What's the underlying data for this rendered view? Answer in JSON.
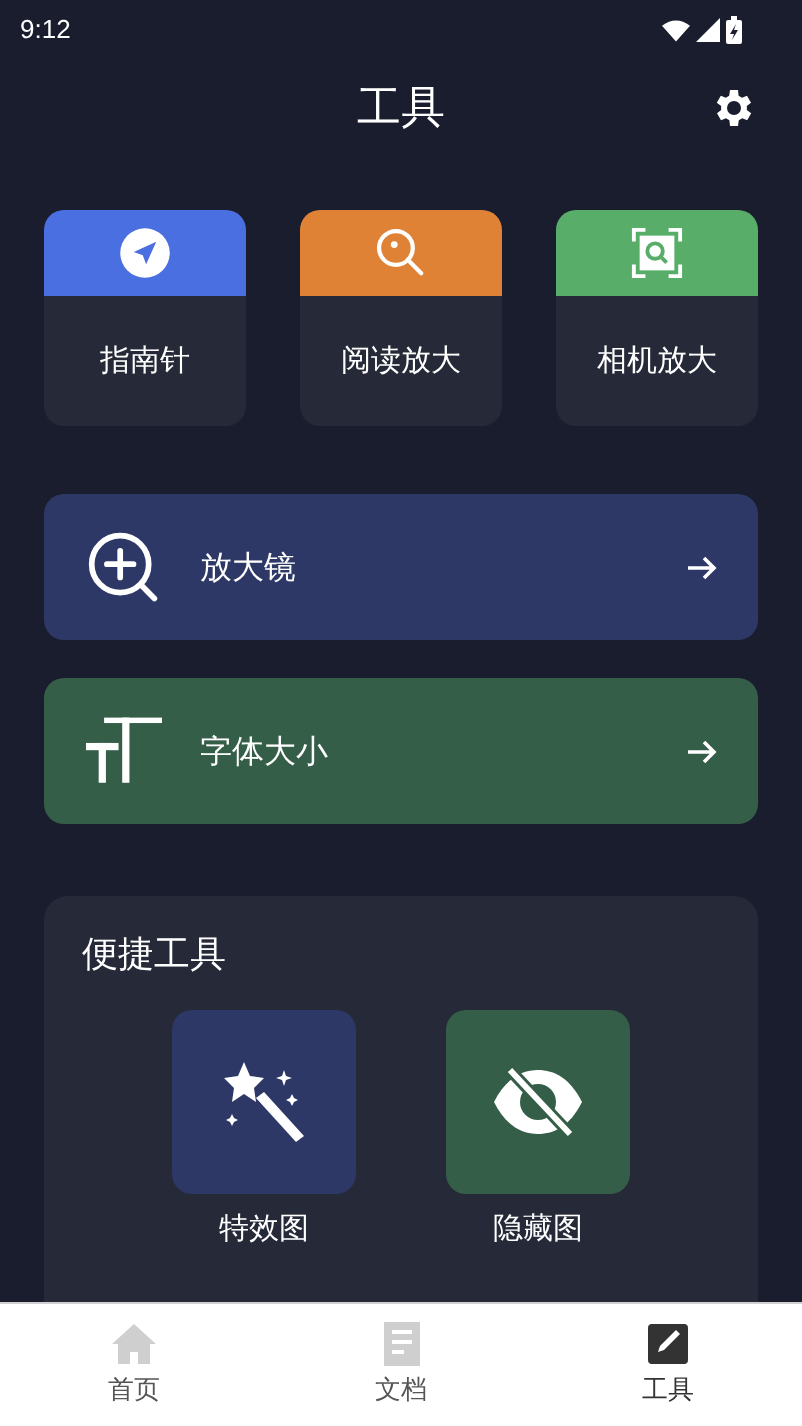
{
  "status_bar": {
    "time": "9:12"
  },
  "header": {
    "title": "工具"
  },
  "tiles": [
    {
      "label": "指南针",
      "kind": "compass",
      "color": "#4a6fe0"
    },
    {
      "label": "阅读放大",
      "kind": "magnifier",
      "color": "#e08236"
    },
    {
      "label": "相机放大",
      "kind": "camera-scan",
      "color": "#58ae68"
    }
  ],
  "banners": [
    {
      "label": "放大镜",
      "kind": "zoom-in",
      "color": "#2e3866"
    },
    {
      "label": "字体大小",
      "kind": "font-size",
      "color": "#355e48"
    }
  ],
  "quick_tools": {
    "title": "便捷工具",
    "items": [
      {
        "label": "特效图",
        "kind": "magic-wand",
        "color": "#2e3866"
      },
      {
        "label": "隐藏图",
        "kind": "eye-off",
        "color": "#355e48"
      }
    ]
  },
  "bottom_nav": [
    {
      "label": "首页",
      "kind": "home",
      "selected": false
    },
    {
      "label": "文档",
      "kind": "document",
      "selected": false
    },
    {
      "label": "工具",
      "kind": "tool",
      "selected": true
    }
  ]
}
